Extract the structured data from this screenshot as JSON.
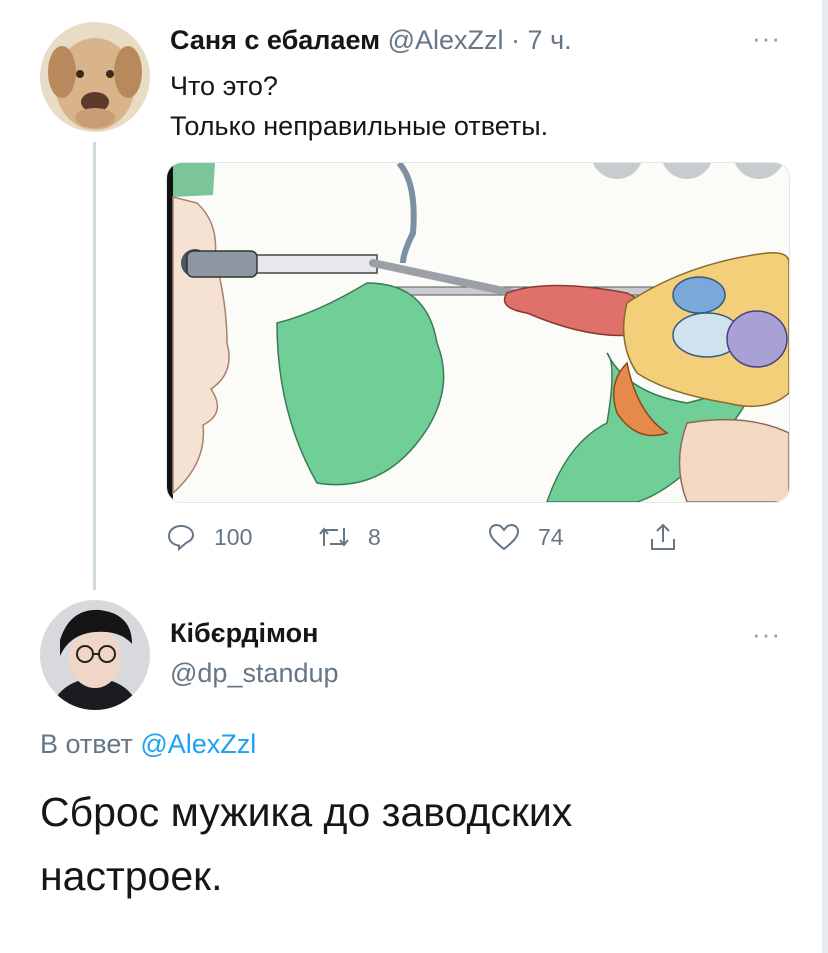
{
  "tweet1": {
    "author_name": "Саня с ебалаем",
    "handle": "@AlexZzl",
    "separator": " · ",
    "time": "7 ч.",
    "text_line1": "Что это?",
    "text_line2": "Только неправильные ответы.",
    "more_label": "···",
    "actions": {
      "reply_count": "100",
      "retweet_count": "8",
      "like_count": "74"
    }
  },
  "tweet2": {
    "author_name": "Кібєрдімон",
    "handle": "@dp_standup",
    "more_label": "···",
    "reply_prefix": "В ответ ",
    "reply_mention": "@AlexZzl",
    "text": "Сброс мужика до заводских настроек."
  },
  "colors": {
    "link": "#1da1f2",
    "secondary_text": "#657786",
    "primary_text": "#14171a",
    "thread_line": "#cfd9de"
  }
}
